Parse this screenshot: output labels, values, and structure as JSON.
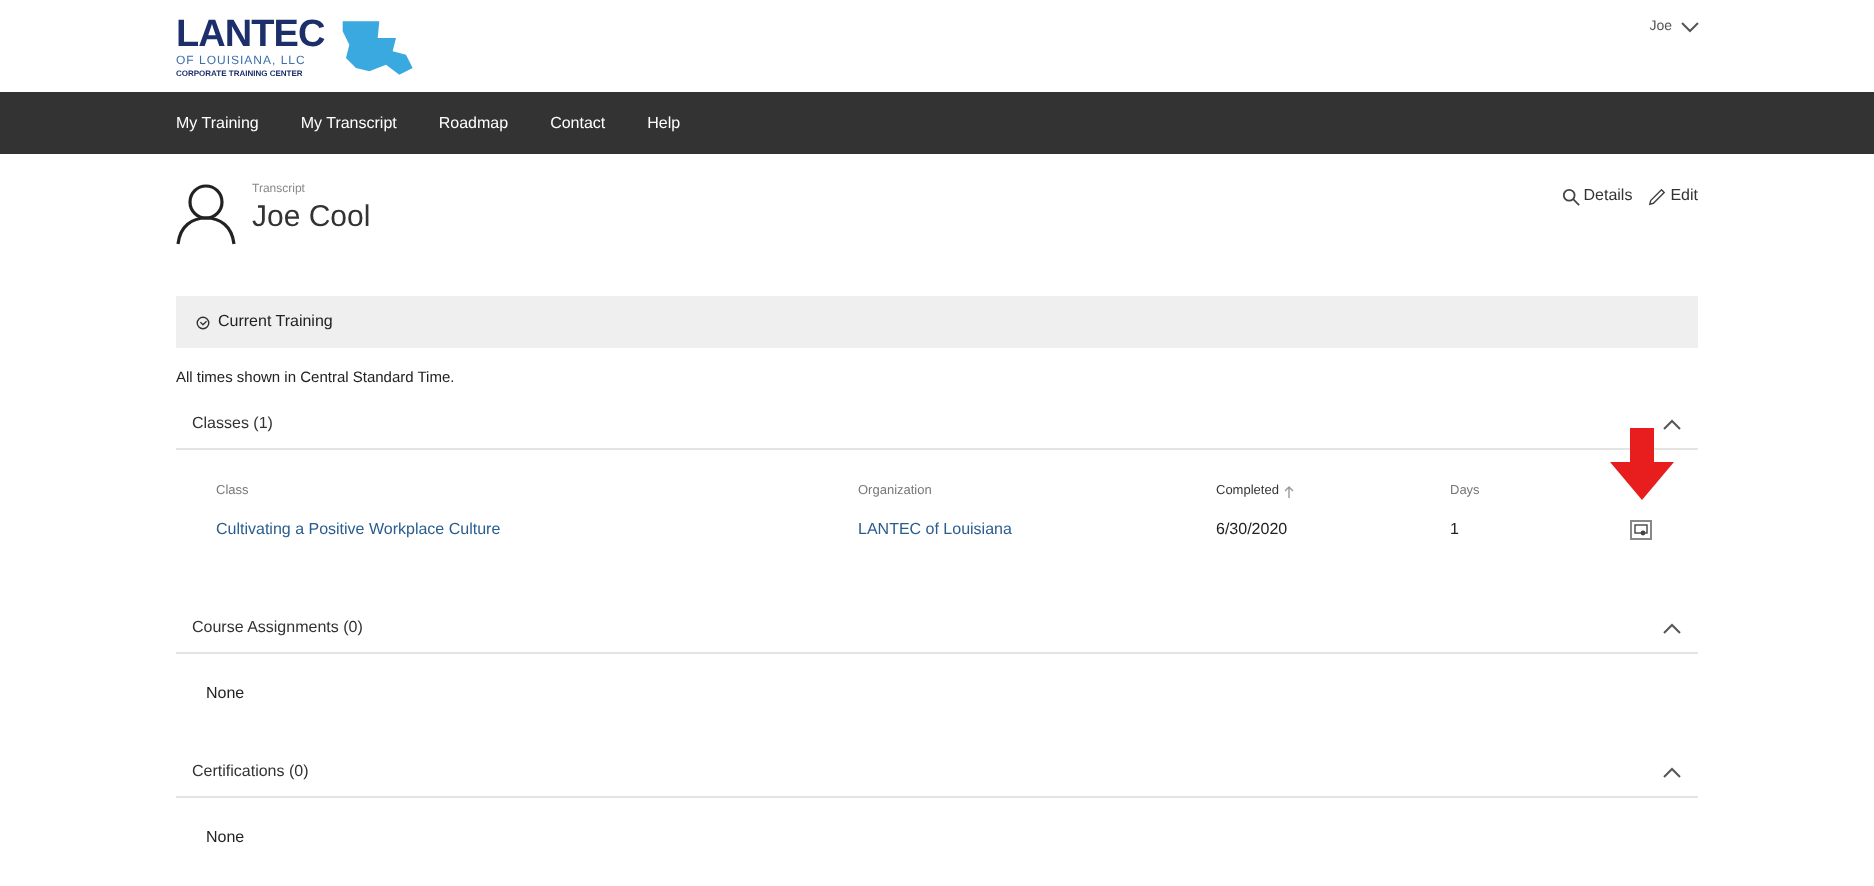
{
  "logo": {
    "name": "LANTEC",
    "subtitle": "OF LOUISIANA, LLC",
    "tagline": "CORPORATE TRAINING CENTER"
  },
  "user_menu": {
    "label": "Joe"
  },
  "nav": [
    {
      "label": "My Training"
    },
    {
      "label": "My Transcript"
    },
    {
      "label": "Roadmap"
    },
    {
      "label": "Contact"
    },
    {
      "label": "Help"
    }
  ],
  "profile": {
    "caption": "Transcript",
    "name": "Joe Cool"
  },
  "actions": [
    {
      "kind": "details",
      "label": "Details"
    },
    {
      "kind": "edit",
      "label": "Edit"
    }
  ],
  "filter_bar": {
    "label": "Current Training"
  },
  "timezone_note": "All times shown in Central Standard Time.",
  "sections": [
    {
      "title": "Classes (1)",
      "expanded": true,
      "table": {
        "columns": [
          {
            "label": "Class",
            "sorted": false
          },
          {
            "label": "Organization",
            "sorted": false
          },
          {
            "label": "Completed",
            "sorted": true
          },
          {
            "label": "Days",
            "sorted": false
          }
        ],
        "rows": [
          {
            "class": "Cultivating a Positive Workplace Culture",
            "organization": "LANTEC of Louisiana",
            "completed": "6/30/2020",
            "days": "1",
            "annotated": true
          }
        ]
      }
    },
    {
      "title": "Course Assignments (0)",
      "expanded": true,
      "empty_text": "None"
    },
    {
      "title": "Certifications (0)",
      "expanded": true,
      "empty_text": "None"
    }
  ]
}
